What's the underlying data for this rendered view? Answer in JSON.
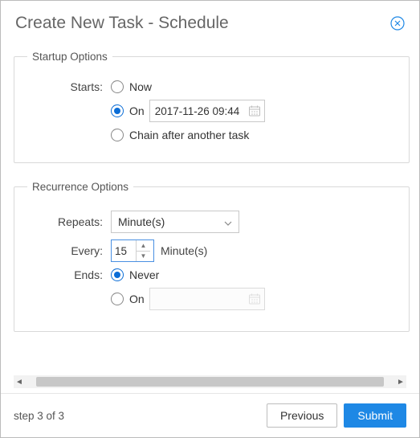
{
  "title": "Create New Task - Schedule",
  "startup": {
    "legend": "Startup Options",
    "label_starts": "Starts:",
    "option_now": "Now",
    "option_on": "On",
    "option_chain": "Chain after another task",
    "selected": "on",
    "on_datetime": "2017-11-26 09:44"
  },
  "recurrence": {
    "legend": "Recurrence Options",
    "label_repeats": "Repeats:",
    "repeats_value": "Minute(s)",
    "label_every": "Every:",
    "every_value": "15",
    "every_unit": "Minute(s)",
    "label_ends": "Ends:",
    "ends_selected": "never",
    "option_never": "Never",
    "option_on": "On",
    "end_on_value": ""
  },
  "footer": {
    "step_text": "step 3 of 3",
    "previous": "Previous",
    "submit": "Submit"
  }
}
